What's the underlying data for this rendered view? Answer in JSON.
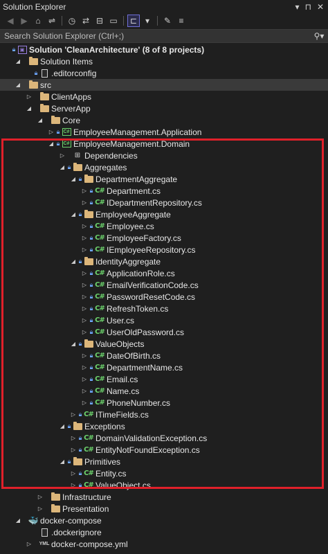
{
  "window": {
    "title": "Solution Explorer",
    "pin": "▾ ⊓ ✕"
  },
  "search": {
    "placeholder": "Search Solution Explorer (Ctrl+;)"
  },
  "tree": [
    {
      "depth": 0,
      "chev": "none",
      "lock": true,
      "icon": "sln",
      "label": "Solution 'CleanArchitecture' (8 of 8 projects)",
      "bold": true
    },
    {
      "depth": 1,
      "chev": "down",
      "lock": false,
      "icon": "folder",
      "label": "Solution Items"
    },
    {
      "depth": 2,
      "chev": "none",
      "lock": true,
      "icon": "file",
      "label": ".editorconfig"
    },
    {
      "depth": 1,
      "chev": "down",
      "lock": false,
      "icon": "folder",
      "label": "src",
      "highlight": true
    },
    {
      "depth": 2,
      "chev": "right",
      "lock": false,
      "icon": "folder",
      "label": "ClientApps"
    },
    {
      "depth": 2,
      "chev": "down",
      "lock": false,
      "icon": "folder",
      "label": "ServerApp"
    },
    {
      "depth": 3,
      "chev": "down",
      "lock": false,
      "icon": "folder",
      "label": "Core"
    },
    {
      "depth": 4,
      "chev": "right",
      "lock": true,
      "icon": "proj",
      "label": "EmployeeManagement.Application"
    },
    {
      "depth": 4,
      "chev": "down",
      "lock": true,
      "icon": "proj",
      "label": "EmployeeManagement.Domain"
    },
    {
      "depth": 5,
      "chev": "right",
      "lock": false,
      "icon": "dep",
      "label": "Dependencies"
    },
    {
      "depth": 5,
      "chev": "down",
      "lock": true,
      "icon": "folder",
      "label": "Aggregates"
    },
    {
      "depth": 6,
      "chev": "down",
      "lock": true,
      "icon": "folder",
      "label": "DepartmentAggregate"
    },
    {
      "depth": 7,
      "chev": "right",
      "lock": true,
      "icon": "cs",
      "label": "Department.cs"
    },
    {
      "depth": 7,
      "chev": "right",
      "lock": true,
      "icon": "cs",
      "label": "IDepartmentRepository.cs"
    },
    {
      "depth": 6,
      "chev": "down",
      "lock": true,
      "icon": "folder",
      "label": "EmployeeAggregate"
    },
    {
      "depth": 7,
      "chev": "right",
      "lock": true,
      "icon": "cs",
      "label": "Employee.cs"
    },
    {
      "depth": 7,
      "chev": "right",
      "lock": true,
      "icon": "cs",
      "label": "EmployeeFactory.cs"
    },
    {
      "depth": 7,
      "chev": "right",
      "lock": true,
      "icon": "cs",
      "label": "IEmployeeRepository.cs"
    },
    {
      "depth": 6,
      "chev": "down",
      "lock": true,
      "icon": "folder",
      "label": "IdentityAggregate"
    },
    {
      "depth": 7,
      "chev": "right",
      "lock": true,
      "icon": "cs",
      "label": "ApplicationRole.cs"
    },
    {
      "depth": 7,
      "chev": "right",
      "lock": true,
      "icon": "cs",
      "label": "EmailVerificationCode.cs"
    },
    {
      "depth": 7,
      "chev": "right",
      "lock": true,
      "icon": "cs",
      "label": "PasswordResetCode.cs"
    },
    {
      "depth": 7,
      "chev": "right",
      "lock": true,
      "icon": "cs",
      "label": "RefreshToken.cs"
    },
    {
      "depth": 7,
      "chev": "right",
      "lock": true,
      "icon": "cs",
      "label": "User.cs"
    },
    {
      "depth": 7,
      "chev": "right",
      "lock": true,
      "icon": "cs",
      "label": "UserOldPassword.cs"
    },
    {
      "depth": 6,
      "chev": "down",
      "lock": true,
      "icon": "folder",
      "label": "ValueObjects"
    },
    {
      "depth": 7,
      "chev": "right",
      "lock": true,
      "icon": "cs",
      "label": "DateOfBirth.cs"
    },
    {
      "depth": 7,
      "chev": "right",
      "lock": true,
      "icon": "cs",
      "label": "DepartmentName.cs"
    },
    {
      "depth": 7,
      "chev": "right",
      "lock": true,
      "icon": "cs",
      "label": "Email.cs"
    },
    {
      "depth": 7,
      "chev": "right",
      "lock": true,
      "icon": "cs",
      "label": "Name.cs"
    },
    {
      "depth": 7,
      "chev": "right",
      "lock": true,
      "icon": "cs",
      "label": "PhoneNumber.cs"
    },
    {
      "depth": 6,
      "chev": "right",
      "lock": true,
      "icon": "cs",
      "label": "ITimeFields.cs"
    },
    {
      "depth": 5,
      "chev": "down",
      "lock": true,
      "icon": "folder",
      "label": "Exceptions"
    },
    {
      "depth": 6,
      "chev": "right",
      "lock": true,
      "icon": "cs",
      "label": "DomainValidationException.cs"
    },
    {
      "depth": 6,
      "chev": "right",
      "lock": true,
      "icon": "cs",
      "label": "EntityNotFoundException.cs"
    },
    {
      "depth": 5,
      "chev": "down",
      "lock": true,
      "icon": "folder",
      "label": "Primitives"
    },
    {
      "depth": 6,
      "chev": "right",
      "lock": true,
      "icon": "cs",
      "label": "Entity.cs"
    },
    {
      "depth": 6,
      "chev": "right",
      "lock": true,
      "icon": "cs",
      "label": "ValueObject.cs"
    },
    {
      "depth": 3,
      "chev": "right",
      "lock": false,
      "icon": "folder",
      "label": "Infrastructure"
    },
    {
      "depth": 3,
      "chev": "right",
      "lock": false,
      "icon": "folder",
      "label": "Presentation"
    },
    {
      "depth": 1,
      "chev": "down",
      "lock": false,
      "icon": "docker",
      "label": "docker-compose"
    },
    {
      "depth": 2,
      "chev": "none",
      "lock": false,
      "icon": "file",
      "label": ".dockerignore"
    },
    {
      "depth": 2,
      "chev": "right",
      "lock": false,
      "icon": "yml",
      "label": "docker-compose.yml"
    }
  ],
  "icon_text": {
    "cs": "C#",
    "proj": "C#",
    "yml": "YML",
    "sln": "▣",
    "dep": "⊞",
    "docker": "🐳"
  },
  "colors": {
    "highlight_box": "#e0202a",
    "folder": "#dcb67a",
    "csharp": "#6dd46d",
    "background": "#1f1f1f"
  }
}
